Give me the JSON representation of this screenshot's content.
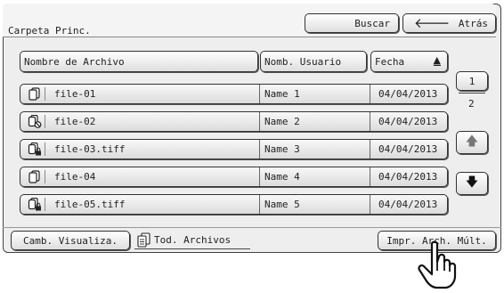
{
  "header": {
    "folder_label": "Carpeta Princ.",
    "search_label": "Buscar",
    "back_label": "Atrás"
  },
  "columns": {
    "name": "Nombre de Archivo",
    "user": "Nomb. Usuario",
    "date": "Fecha",
    "date_sort": "ascending"
  },
  "files": [
    {
      "name": "file-01",
      "user": "Name 1",
      "date": "04/04/2013",
      "icon": "document-copy-icon"
    },
    {
      "name": "file-02",
      "user": "Name 2",
      "date": "04/04/2013",
      "icon": "document-prohibited-icon"
    },
    {
      "name": "file-03.tiff",
      "user": "Name 3",
      "date": "04/04/2013",
      "icon": "document-locked-icon"
    },
    {
      "name": "file-04",
      "user": "Name 4",
      "date": "04/04/2013",
      "icon": "document-copy-icon"
    },
    {
      "name": "file-05.tiff",
      "user": "Name 5",
      "date": "04/04/2013",
      "icon": "document-locked-icon"
    }
  ],
  "pagination": {
    "current": "1",
    "total": "2"
  },
  "footer": {
    "view_label": "Camb. Visualiza.",
    "all_files_label": "Tod. Archivos",
    "print_label": "Impr. Arch. Múlt."
  }
}
